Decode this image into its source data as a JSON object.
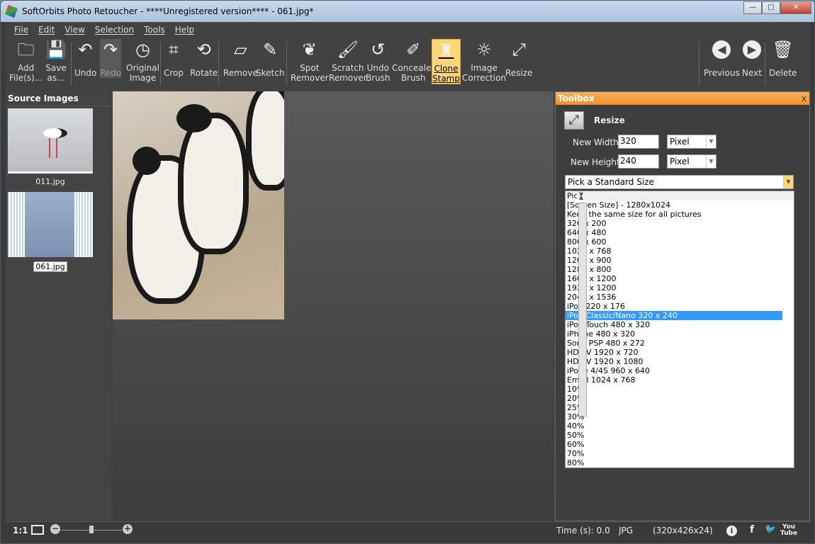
{
  "window": {
    "title": "SoftOrbits Photo Retoucher - ****Unregistered version**** - 061.jpg*"
  },
  "menu": [
    "File",
    "Edit",
    "View",
    "Selection",
    "Tools",
    "Help"
  ],
  "toolbar": [
    {
      "l1": "Add",
      "l2": "File(s)...",
      "icon": "folder-open"
    },
    {
      "l1": "Save",
      "l2": "as...",
      "icon": "floppy-disk"
    },
    {
      "l1": "Undo",
      "l2": "",
      "icon": "undo"
    },
    {
      "l1": "Redo",
      "l2": "",
      "icon": "redo",
      "state": "disabled"
    },
    {
      "l1": "Original",
      "l2": "Image",
      "icon": "history-clock"
    },
    {
      "l1": "Crop",
      "l2": "",
      "icon": "crop"
    },
    {
      "l1": "Rotate",
      "l2": "",
      "icon": "rotate"
    },
    {
      "l1": "Remove",
      "l2": "",
      "icon": "eraser"
    },
    {
      "l1": "Sketch",
      "l2": "",
      "icon": "sketch"
    },
    {
      "l1": "Spot",
      "l2": "Remover",
      "icon": "spot-remover"
    },
    {
      "l1": "Scratch",
      "l2": "Remover",
      "icon": "brush"
    },
    {
      "l1": "Undo",
      "l2": "Brush",
      "icon": "undo-brush"
    },
    {
      "l1": "Concealer",
      "l2": "Brush",
      "icon": "concealer"
    },
    {
      "l1": "Clone",
      "l2": "Stamp",
      "icon": "stamp",
      "state": "active"
    },
    {
      "l1": "Image",
      "l2": "Correction",
      "icon": "sun"
    },
    {
      "l1": "Resize",
      "l2": "",
      "icon": "resize-arrows"
    },
    {
      "l1": "Previous",
      "l2": "",
      "icon": "arrow-left-circle"
    },
    {
      "l1": "Next",
      "l2": "",
      "icon": "arrow-right-circle"
    },
    {
      "l1": "Delete",
      "l2": "",
      "icon": "trash"
    }
  ],
  "source_images": {
    "title": "Source Images",
    "items": [
      {
        "name": "011.jpg"
      },
      {
        "name": "061.jpg",
        "selected": true
      }
    ]
  },
  "toolbox": {
    "title": "Toolbox",
    "close": "x",
    "section": "Resize",
    "width_label": "New Width",
    "width_value": "320",
    "width_unit": "Pixel",
    "height_label": "New Height",
    "height_value": "240",
    "height_unit": "Pixel",
    "standard_size": "Pick a Standard Size",
    "options": [
      "Pick a Standard Size",
      "[Screen Size] - 1280x1024",
      "Keep the same size for all pictures",
      "320 x 200",
      "640 x 480",
      "800 x 600",
      "1024 x 768",
      "1200 x 900",
      "1280 x 800",
      "1600 x 1200",
      "1920 x 1200",
      "2048 x 1536",
      "iPod 220 x 176",
      "iPod Classic/Nano 320 x 240",
      "iPod Touch 480 x 320",
      "iPhone 480 x 320",
      "Sony PSP 480 x 272",
      "HD TV 1920 x 720",
      "HD TV 1920 x 1080",
      "iPone 4/4S 960 x 640",
      "Email 1024 x 768",
      "10%",
      "20%",
      "25%",
      "30%",
      "40%",
      "50%",
      "60%",
      "70%",
      "80%"
    ],
    "highlighted": "iPod Classic/Nano 320 x 240"
  },
  "status": {
    "zoom_label": "1:1",
    "zoom_level": 0.5,
    "time": "Time (s): 0.0",
    "format": "JPG",
    "dimensions": "(320x426x24)"
  },
  "colors": {
    "accent": "#f0902c",
    "selection": "#3399ff",
    "active_tool": "#ffd57a"
  }
}
